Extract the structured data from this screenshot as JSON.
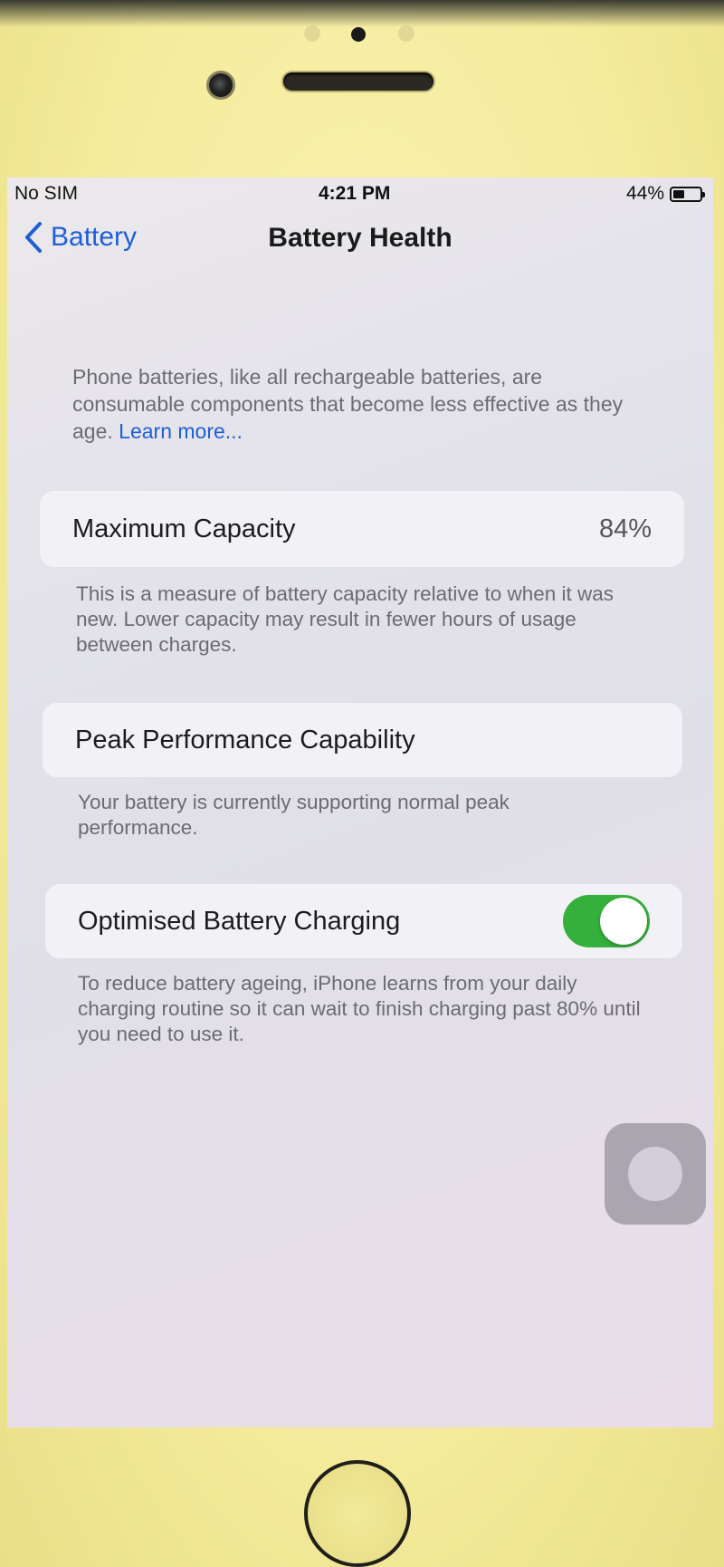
{
  "status_bar": {
    "carrier": "No SIM",
    "time": "4:21 PM",
    "battery_percent": "44%",
    "battery_level": 0.44
  },
  "nav": {
    "back_label": "Battery",
    "title": "Battery Health",
    "back_icon": "chevron-left-icon"
  },
  "intro": {
    "text": "Phone batteries, like all rechargeable batteries, are consumable components that become less effective as they age. ",
    "link": "Learn more..."
  },
  "maximum_capacity": {
    "label": "Maximum Capacity",
    "value": "84%",
    "footer": "This is a measure of battery capacity relative to when it was new. Lower capacity may result in fewer hours of usage between charges."
  },
  "peak_performance": {
    "label": "Peak Performance Capability",
    "footer": "Your battery is currently supporting normal peak performance."
  },
  "optimised_charging": {
    "label": "Optimised Battery Charging",
    "enabled": true,
    "footer": "To reduce battery ageing, iPhone learns from your daily charging routine so it can wait to finish charging past 80% until you need to use it."
  },
  "colors": {
    "accent": "#1d5fd6",
    "toggle_on": "#36b03c",
    "bezel": "#f4eb9c"
  }
}
